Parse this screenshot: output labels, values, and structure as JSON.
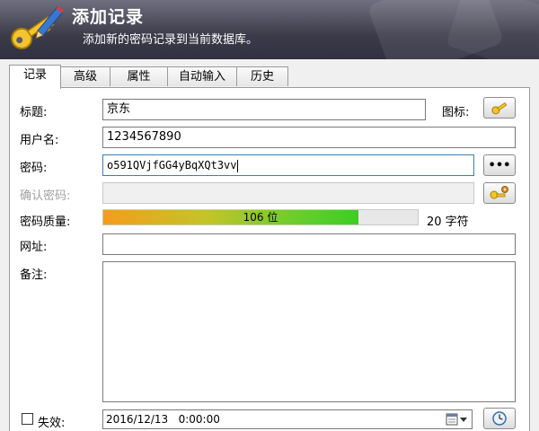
{
  "banner": {
    "title": "添加记录",
    "subtitle": "添加新的密码记录到当前数据库。",
    "icon": "key-pencil-icon"
  },
  "tabs": [
    {
      "label": "记录",
      "active": true
    },
    {
      "label": "高级",
      "active": false
    },
    {
      "label": "属性",
      "active": false
    },
    {
      "label": "自动输入",
      "active": false
    },
    {
      "label": "历史",
      "active": false
    }
  ],
  "form": {
    "title_label": "标题:",
    "title_value": "京东",
    "icon_label": "图标:",
    "username_label": "用户名:",
    "username_value": "1234567890",
    "password_label": "密码:",
    "password_value": "o591QVjfGG4yBqXQt3vv",
    "reveal_button_label": "•••",
    "confirm_label": "确认密码:",
    "confirm_value": "",
    "quality_label": "密码质量:",
    "quality_bits": "106 位",
    "quality_fraction": 0.81,
    "char_count": "20 字符",
    "url_label": "网址:",
    "url_value": "",
    "notes_label": "备注:",
    "notes_value": "",
    "expires_label": "失效:",
    "expires_checked": false,
    "expires_value": "2016/12/13   0:00:00"
  },
  "colors": {
    "banner_dark": "#303040",
    "quality_start": "#f49c1c",
    "quality_end": "#3fcc24",
    "focus_border": "#3c7fb1"
  }
}
